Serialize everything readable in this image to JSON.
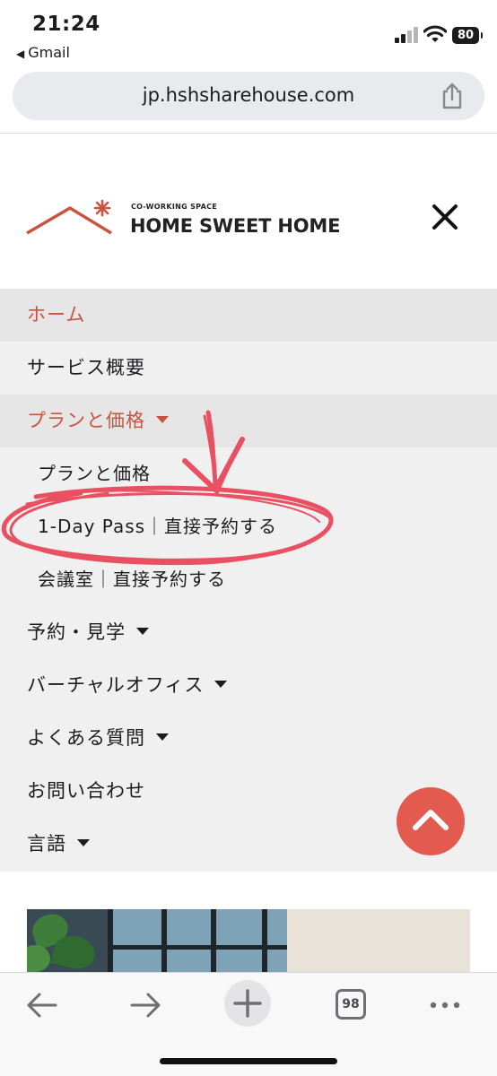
{
  "status": {
    "time": "21:24",
    "back_app": "Gmail",
    "battery": "80"
  },
  "browser": {
    "url": "jp.hshsharehouse.com",
    "tab_count": "98"
  },
  "logo": {
    "subtitle": "CO-WORKING SPACE",
    "title": "HOME SWEET HOME"
  },
  "menu": {
    "items": [
      {
        "label": "ホーム",
        "active": true
      },
      {
        "label": "サービス概要"
      },
      {
        "label": "プランと価格",
        "expanded": true
      },
      {
        "label": "プランと価格",
        "sub": true
      },
      {
        "label": "1-Day Pass｜直接予約する",
        "sub": true,
        "circled": true
      },
      {
        "label": "会議室｜直接予約する",
        "sub": true
      },
      {
        "label": "予約・見学"
      },
      {
        "label": "バーチャルオフィス"
      },
      {
        "label": "よくある質問"
      },
      {
        "label": "お問い合わせ"
      },
      {
        "label": "言語"
      }
    ]
  },
  "colors": {
    "accent": "#c9533f",
    "scroll_top_button": "#e35a4e",
    "menu_bg": "#f0f0f1",
    "annotation": "#e8364a"
  },
  "icons": {
    "close": "close-icon",
    "share": "share-icon",
    "back": "arrow-left-icon",
    "forward": "arrow-right-icon",
    "new_tab": "plus-icon",
    "more": "more-icon",
    "scroll_top": "chevron-up-icon"
  }
}
